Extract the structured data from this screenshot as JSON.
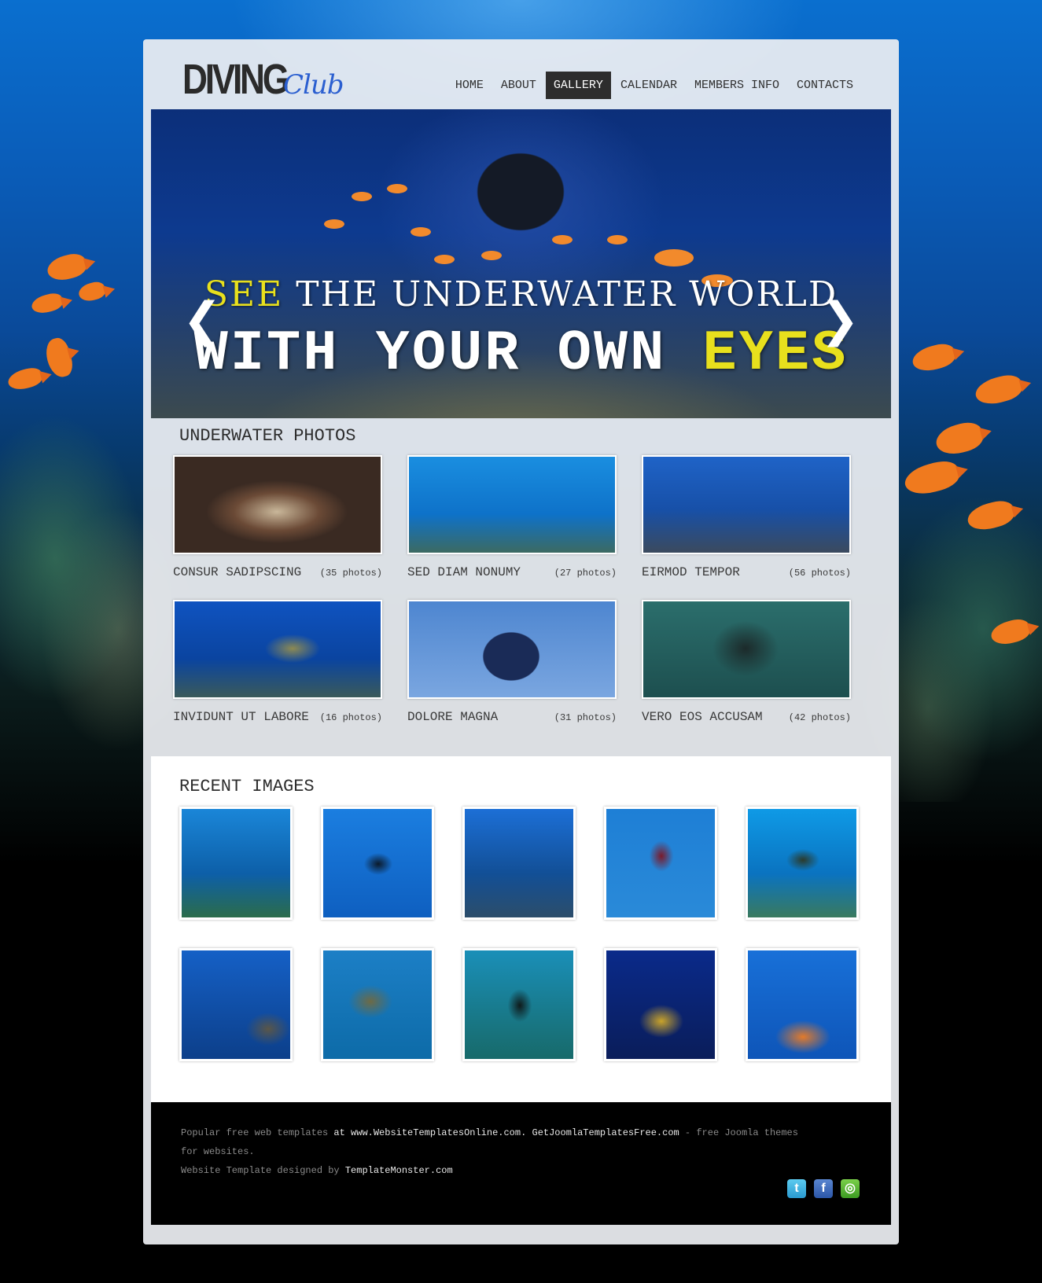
{
  "site": {
    "logo_main": "DIVING",
    "logo_script": "Club"
  },
  "nav": {
    "items": [
      {
        "label": "HOME"
      },
      {
        "label": "ABOUT"
      },
      {
        "label": "GALLERY",
        "active": true
      },
      {
        "label": "CALENDAR"
      },
      {
        "label": "MEMBERS INFO"
      },
      {
        "label": "CONTACTS"
      }
    ]
  },
  "banner": {
    "line1_highlight": "SEE",
    "line1_rest": " THE UNDERWATER WORLD",
    "line2_rest": "WITH YOUR OWN ",
    "line2_highlight": "EYES",
    "prev_glyph": "❮",
    "next_glyph": "❯"
  },
  "gallery": {
    "title": "UNDERWATER PHOTOS",
    "albums": [
      {
        "title": "CONSUR SADIPSCING",
        "count": "(35 photos)"
      },
      {
        "title": "SED DIAM NONUMY",
        "count": "(27 photos)"
      },
      {
        "title": "EIRMOD TEMPOR",
        "count": "(56 photos)"
      },
      {
        "title": "INVIDUNT UT LABORE",
        "count": "(16 photos)"
      },
      {
        "title": "DOLORE MAGNA",
        "count": "(31 photos)"
      },
      {
        "title": "VERO EOS ACCUSAM",
        "count": "(42 photos)"
      }
    ]
  },
  "recent": {
    "title": "RECENT IMAGES"
  },
  "footer": {
    "line1_a": "Popular free web templates",
    "line1_b": " at ",
    "line1_c": "www.WebsiteTemplatesOnline.com.",
    "line1_d": " ",
    "line1_e": "GetJoomlaTemplatesFree.com",
    "line1_f": " - free Joomla themes for websites.",
    "line2_a": "Website Template designed by ",
    "line2_b": "TemplateMonster.com"
  },
  "social": {
    "icons": [
      "twitter-icon",
      "facebook-icon",
      "chat-icon"
    ]
  },
  "colors": {
    "accent_yellow": "#e8e01d",
    "nav_active_bg": "#2d2d2d",
    "logo_script": "#2b5fd0",
    "footer_bg": "#000000"
  }
}
